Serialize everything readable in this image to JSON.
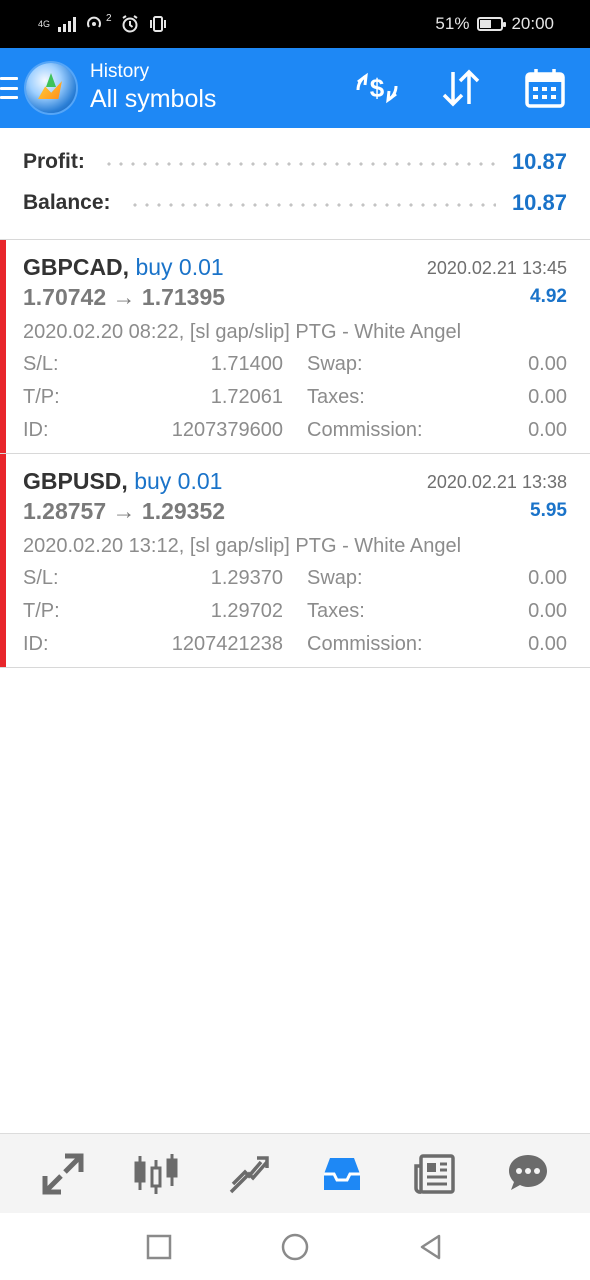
{
  "status": {
    "network": "4G",
    "sim": "2",
    "battery": "51%",
    "battery_level": 0.51,
    "time": "20:00"
  },
  "header": {
    "subtitle": "History",
    "title": "All symbols",
    "icons": [
      "currency-exchange-icon",
      "sort-icon",
      "calendar-icon"
    ]
  },
  "summary": {
    "profit_label": "Profit:",
    "profit_value": "10.87",
    "balance_label": "Balance:",
    "balance_value": "10.87"
  },
  "trades": [
    {
      "symbol": "GBPCAD,",
      "direction": "buy 0.01",
      "close_time": "2020.02.21 13:45",
      "prices": "1.70742 → 1.71395",
      "profit": "4.92",
      "comment": "2020.02.20 08:22, [sl gap/slip] PTG - White Angel",
      "sl_label": "S/L:",
      "sl": "1.71400",
      "swap_label": "Swap:",
      "swap": "0.00",
      "tp_label": "T/P:",
      "tp": "1.72061",
      "taxes_label": "Taxes:",
      "taxes": "0.00",
      "id_label": "ID:",
      "id": "1207379600",
      "commission_label": "Commission:",
      "commission": "0.00"
    },
    {
      "symbol": "GBPUSD,",
      "direction": "buy 0.01",
      "close_time": "2020.02.21 13:38",
      "prices": "1.28757 → 1.29352",
      "profit": "5.95",
      "comment": "2020.02.20 13:12, [sl gap/slip] PTG - White Angel",
      "sl_label": "S/L:",
      "sl": "1.29370",
      "swap_label": "Swap:",
      "swap": "0.00",
      "tp_label": "T/P:",
      "tp": "1.29702",
      "taxes_label": "Taxes:",
      "taxes": "0.00",
      "id_label": "ID:",
      "id": "1207421238",
      "commission_label": "Commission:",
      "commission": "0.00"
    }
  ],
  "bottom_nav": {
    "items": [
      "quotes-icon",
      "chart-icon",
      "trade-icon",
      "history-icon",
      "news-icon",
      "chat-icon"
    ],
    "active": "history-icon"
  },
  "colors": {
    "accent": "#1e88f5",
    "value_blue": "#1a73c9",
    "buy_marker": "#e8262b"
  }
}
